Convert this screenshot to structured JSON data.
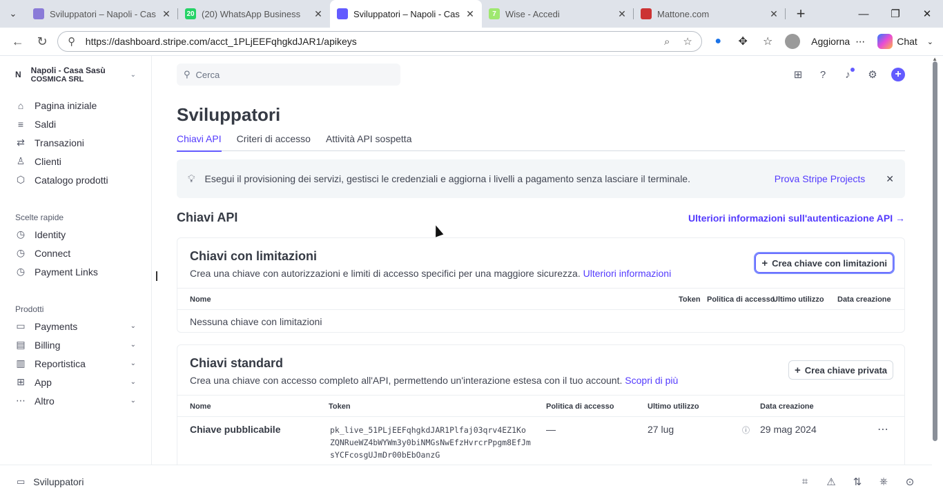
{
  "browser": {
    "tabs": [
      {
        "title": "Sviluppatori – Napoli - Casa Sasù",
        "favicon_color": "#8a7bd8",
        "favicon_text": ""
      },
      {
        "title": "(20) WhatsApp Business",
        "favicon_color": "#25d366",
        "favicon_text": "20"
      },
      {
        "title": "Sviluppatori – Napoli - Casa Sasù",
        "favicon_color": "#635bff",
        "favicon_text": ""
      },
      {
        "title": "Wise - Accedi",
        "favicon_color": "#9fe870",
        "favicon_text": "7"
      },
      {
        "title": "Mattone.com",
        "favicon_color": "#c33",
        "favicon_text": ""
      }
    ],
    "url": "https://dashboard.stripe.com/acct_1PLjEEFqhgkdJAR1/apikeys",
    "update_label": "Aggiorna",
    "chat_label": "Chat"
  },
  "sidebar": {
    "account_initial": "N",
    "account_name": "Napoli - Casa Sasù",
    "account_company": "COSMICA SRL",
    "main_items": [
      {
        "label": "Pagina iniziale",
        "icon": "home-icon",
        "glyph": "⌂"
      },
      {
        "label": "Saldi",
        "icon": "balance-icon",
        "glyph": "≡"
      },
      {
        "label": "Transazioni",
        "icon": "transactions-icon",
        "glyph": "⇄"
      },
      {
        "label": "Clienti",
        "icon": "customers-icon",
        "glyph": "♙"
      },
      {
        "label": "Catalogo prodotti",
        "icon": "product-catalog-icon",
        "glyph": "⬡"
      }
    ],
    "shortcuts_label": "Scelte rapide",
    "shortcuts": [
      {
        "label": "Identity",
        "icon": "clock-icon",
        "glyph": "◷"
      },
      {
        "label": "Connect",
        "icon": "clock-icon",
        "glyph": "◷"
      },
      {
        "label": "Payment Links",
        "icon": "clock-icon",
        "glyph": "◷"
      }
    ],
    "products_label": "Prodotti",
    "products": [
      {
        "label": "Payments",
        "icon": "payments-icon",
        "glyph": "▭"
      },
      {
        "label": "Billing",
        "icon": "billing-icon",
        "glyph": "▤"
      },
      {
        "label": "Reportistica",
        "icon": "reports-icon",
        "glyph": "▥"
      },
      {
        "label": "App",
        "icon": "apps-icon",
        "glyph": "⊞"
      },
      {
        "label": "Altro",
        "icon": "more-icon",
        "glyph": "⋯"
      }
    ]
  },
  "search": {
    "placeholder": "Cerca"
  },
  "page": {
    "title": "Sviluppatori",
    "tabs": [
      "Chiavi API",
      "Criteri di accesso",
      "Attività API sospetta"
    ],
    "banner_text": "Esegui il provisioning dei servizi, gestisci le credenziali e aggiorna i livelli a pagamento senza lasciare il terminale.",
    "banner_link": "Prova Stripe Projects",
    "section_title": "Chiavi API",
    "section_link": "Ulteriori informazioni sull'autenticazione API →"
  },
  "restricted": {
    "title": "Chiavi con limitazioni",
    "desc": "Crea una chiave con autorizzazioni e limiti di accesso specifici per una maggiore sicurezza.",
    "desc_link": "Ulteriori informazioni",
    "button": "Crea chiave con limitazioni",
    "columns": {
      "name": "Nome",
      "token": "Token",
      "policy": "Politica di accesso",
      "last_used": "Ultimo utilizzo",
      "created": "Data creazione"
    },
    "empty": "Nessuna chiave con limitazioni"
  },
  "standard": {
    "title": "Chiavi standard",
    "desc": "Crea una chiave con accesso completo all'API, permettendo un'interazione estesa con il tuo account.",
    "desc_link": "Scopri di più",
    "button": "Crea chiave privata",
    "columns": {
      "name": "Nome",
      "token": "Token",
      "policy": "Politica di accesso",
      "last_used": "Ultimo utilizzo",
      "created": "Data creazione"
    },
    "rows": [
      {
        "name": "Chiave pubblicabile",
        "token_lines": [
          "pk_live_51PLjEEFqhgkdJAR1Plfaj03qrv4EZ1Ko",
          "ZQNRueWZ4bWYWm3y0biNMGsNwEfzHvrcrPpgm8EfJm",
          "sYCFcosgUJmDr00bEbOanzG"
        ],
        "policy": "—",
        "last_used": "27 lug",
        "created": "29 mag 2024"
      }
    ]
  },
  "bottombar": {
    "label": "Sviluppatori"
  }
}
